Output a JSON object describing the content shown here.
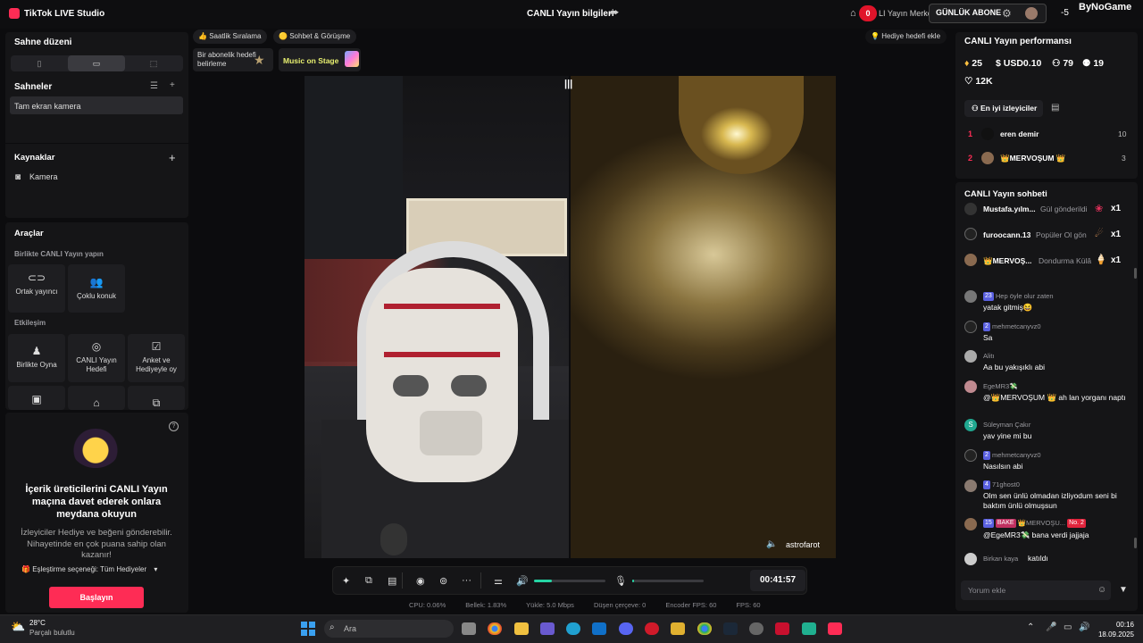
{
  "titlebar": {
    "app_name": "TikTok LIVE Studio",
    "center_title": "CANLI Yayın bilgileri"
  },
  "overlay": {
    "red_count": "0",
    "merkez_text": "LI Yayın Merkez",
    "abone_label": "GÜNLÜK ABONE",
    "right_count": "-5",
    "brand": "ByNoGame"
  },
  "left": {
    "scene_layout_title": "Sahne düzeni",
    "scenes_title": "Sahneler",
    "scene_item": "Tam ekran kamera",
    "sources_title": "Kaynaklar",
    "source_item": "Kamera",
    "tools_title": "Araçlar",
    "together_title": "Birlikte CANLI Yayın yapın",
    "tools_row1": [
      "Ortak yayıncı",
      "Çoklu konuk"
    ],
    "interaction_title": "Etkileşim",
    "tools_row2": [
      "Birlikte Oyna",
      "CANLI Yayın Hedefi",
      "Anket ve Hediyeyle oy"
    ]
  },
  "invite": {
    "title": "İçerik üreticilerini CANLI Yayın maçına davet ederek onlara meydana okuyun",
    "desc": "İzleyiciler Hediye ve beğeni gönderebilir. Nihayetinde en çok puana sahip olan kazanır!",
    "match_option": "Eşleştirme seçeneği: Tüm Hediyeler",
    "start_button": "Başlayın"
  },
  "chips": {
    "hourly": "Saatlik Sıralama",
    "chat": "Sohbet & Görüşme",
    "sub_goal": "Bir abonelik hedefi belirleme",
    "music": "Music on Stage",
    "gift_goal": "Hediye hedefi ekle"
  },
  "preview": {
    "guest_name": "astrofarot"
  },
  "controls": {
    "timer": "00:41:57",
    "volume": 0.25,
    "mic": 0.02
  },
  "stats": {
    "cpu": "CPU:  0.06%",
    "mem": "Bellek:  1.83%",
    "upload": "Yükle:  5.0 Mbps",
    "drop": "Düşen çerçeve:  0",
    "encoder": "Encoder FPS:  60",
    "fps": "FPS:  60"
  },
  "perf": {
    "title": "CANLI Yayın performansı",
    "diamonds": "25",
    "usd": "USD0.10",
    "viewers": "79",
    "followers": "19",
    "likes": "12K",
    "top_viewers_tab": "En iyi izleyiciler",
    "top": [
      {
        "rank": "1",
        "name": "eren demir",
        "score": "10"
      },
      {
        "rank": "2",
        "name": "👑MERVOŞUM 👑",
        "score": "3"
      }
    ]
  },
  "chat": {
    "title": "CANLI Yayın sohbeti",
    "gifts": [
      {
        "name": "Mustafa.yılm...",
        "text": "Gül gönderildi",
        "count": "x1"
      },
      {
        "name": "furoocann.13",
        "text": "Popüler Ol gön",
        "count": "x1"
      },
      {
        "name": "👑MERVOŞ...",
        "text": "Dondurma Külâ",
        "count": "x1"
      }
    ],
    "messages": [
      {
        "level": "23",
        "name": "Hep öyle olur zaten",
        "text": "yatak gitmiş😆"
      },
      {
        "level": "2",
        "name": "mehmetcanyvz0",
        "text": "Sa"
      },
      {
        "level": "",
        "name": "Alitı",
        "text": "Aa bu yakışıklı abi"
      },
      {
        "level": "",
        "name": "EgeMR3💸",
        "text": "@👑MERVOŞUM 👑 ah lan yorganı naptı"
      },
      {
        "level": "",
        "name": "Süleyman Çakır",
        "text": "yav yine mi bu"
      },
      {
        "level": "2",
        "name": "mehmetcanyvz0",
        "text": "Nasılsın abi"
      },
      {
        "level": "4",
        "name": "71ghost0",
        "text": "Olm sen ünlü olmadan izliyodum seni bi baktım ünlü olmuşsun"
      },
      {
        "level": "15",
        "name": "👑MERVOŞU...",
        "badge2": "BAKE",
        "badge3": "No. 2",
        "text": "@EgeMR3💸 bana verdi jajjaja"
      },
      {
        "level": "",
        "name": "Birkan kaya",
        "text": "katıldı"
      }
    ],
    "input_placeholder": "Yorum ekle"
  },
  "taskbar": {
    "temp": "28°C",
    "weather": "Parçalı bulutlu",
    "search": "Ara",
    "time": "00:16",
    "date": "18.09.2025"
  }
}
